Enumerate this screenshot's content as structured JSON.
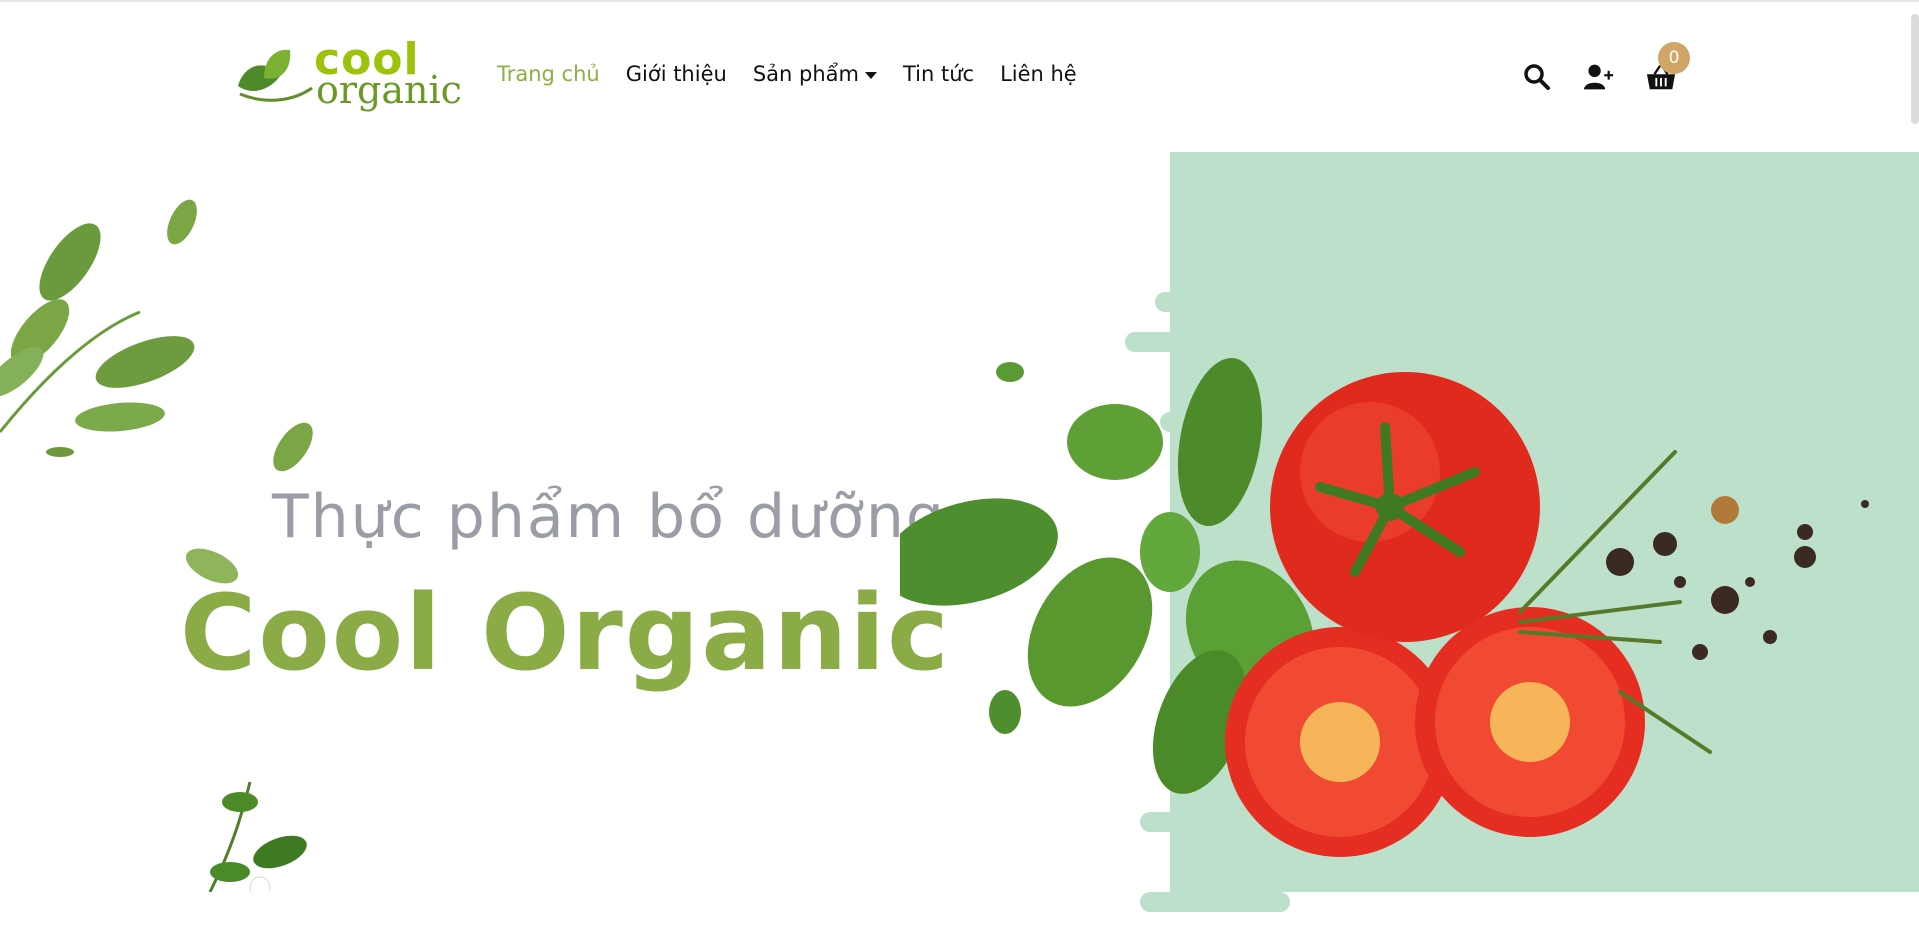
{
  "logo": {
    "line1": "cool",
    "line2": "organic"
  },
  "nav": {
    "items": [
      {
        "label": "Trang chủ",
        "active": true
      },
      {
        "label": "Giới thiệu",
        "active": false
      },
      {
        "label": "Sản phẩm",
        "active": false,
        "has_dropdown": true
      },
      {
        "label": "Tin tức",
        "active": false
      },
      {
        "label": "Liên hệ",
        "active": false
      }
    ]
  },
  "header_icons": {
    "search": "search-icon",
    "account": "user-plus-icon",
    "cart": "basket-icon",
    "cart_count": "0"
  },
  "hero": {
    "subtitle": "Thực phẩm bổ dưỡng",
    "title": "Cool Organic"
  },
  "colors": {
    "accent_green": "#8aab46",
    "logo_green": "#9cc20a",
    "mint_bg": "#bde0ca",
    "badge": "#d0a566",
    "subtitle_gray": "#9b9da6"
  }
}
